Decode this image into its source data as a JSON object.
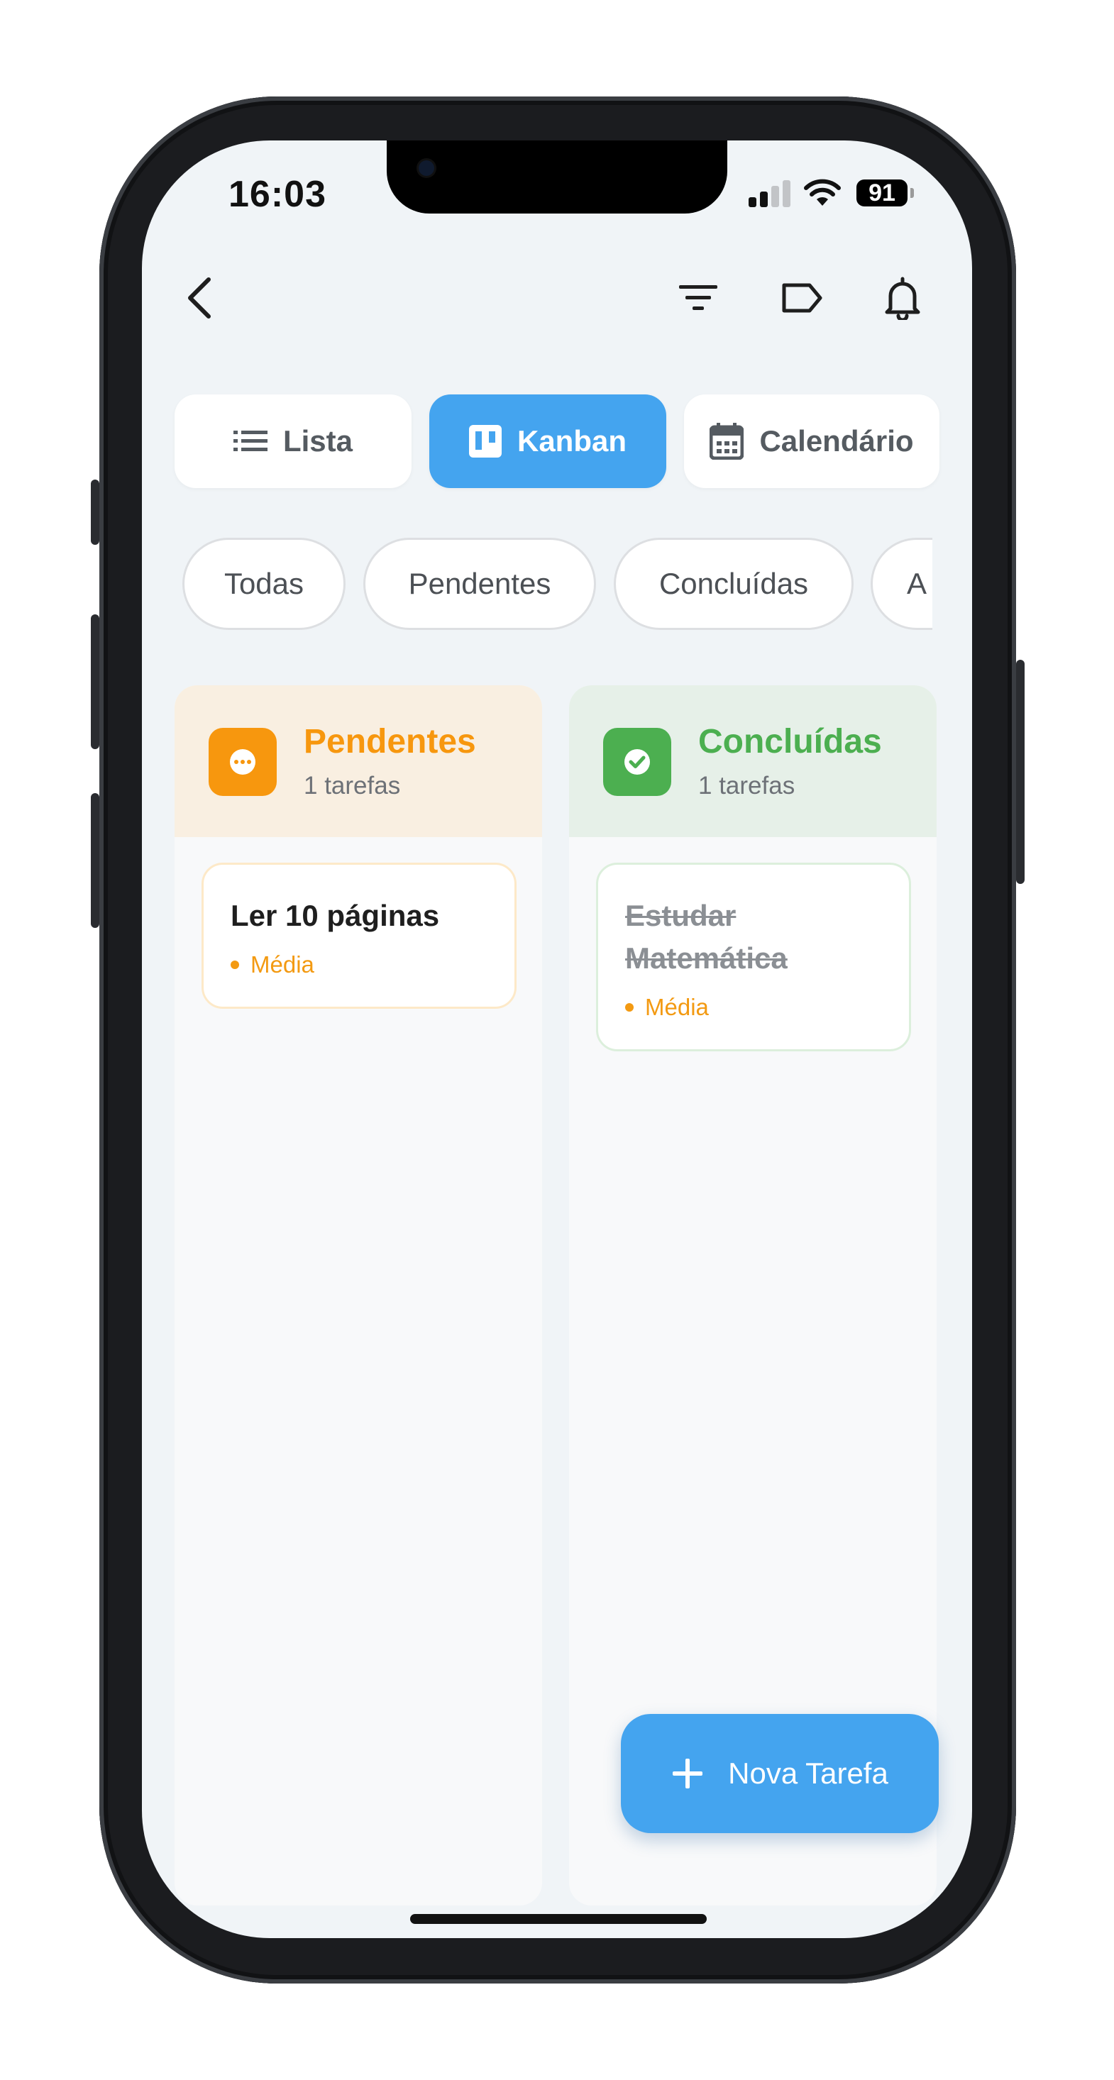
{
  "status_bar": {
    "time": "16:03",
    "battery": "91"
  },
  "header": {
    "back_icon": "chevron-left-icon",
    "actions": [
      {
        "name": "filter-icon"
      },
      {
        "name": "label-icon"
      },
      {
        "name": "bell-icon"
      }
    ]
  },
  "view_tabs": [
    {
      "label": "Lista",
      "icon": "list-icon",
      "active": false
    },
    {
      "label": "Kanban",
      "icon": "kanban-icon",
      "active": true
    },
    {
      "label": "Calendário",
      "icon": "calendar-icon",
      "active": false
    }
  ],
  "filters": [
    {
      "label": "Todas"
    },
    {
      "label": "Pendentes"
    },
    {
      "label": "Concluídas"
    },
    {
      "label": "A"
    }
  ],
  "columns": [
    {
      "title": "Pendentes",
      "count": "1 tarefas",
      "color": "#f7970e",
      "header_bg": "#f9efe1",
      "icon": "more-horizontal-icon",
      "cards": [
        {
          "title": "Ler 10 páginas",
          "priority": "Média",
          "done": false
        }
      ]
    },
    {
      "title": "Concluídas",
      "count": "1 tarefas",
      "color": "#4caf50",
      "header_bg": "#e6f0e8",
      "icon": "check-circle-icon",
      "cards": [
        {
          "title": "Estudar Matemática",
          "priority": "Média",
          "done": true
        }
      ]
    }
  ],
  "fab": {
    "label": "Nova Tarefa",
    "icon": "plus-icon"
  },
  "colors": {
    "accent": "#44a4ef",
    "background": "#f0f4f7",
    "priority": "#f39a12"
  }
}
